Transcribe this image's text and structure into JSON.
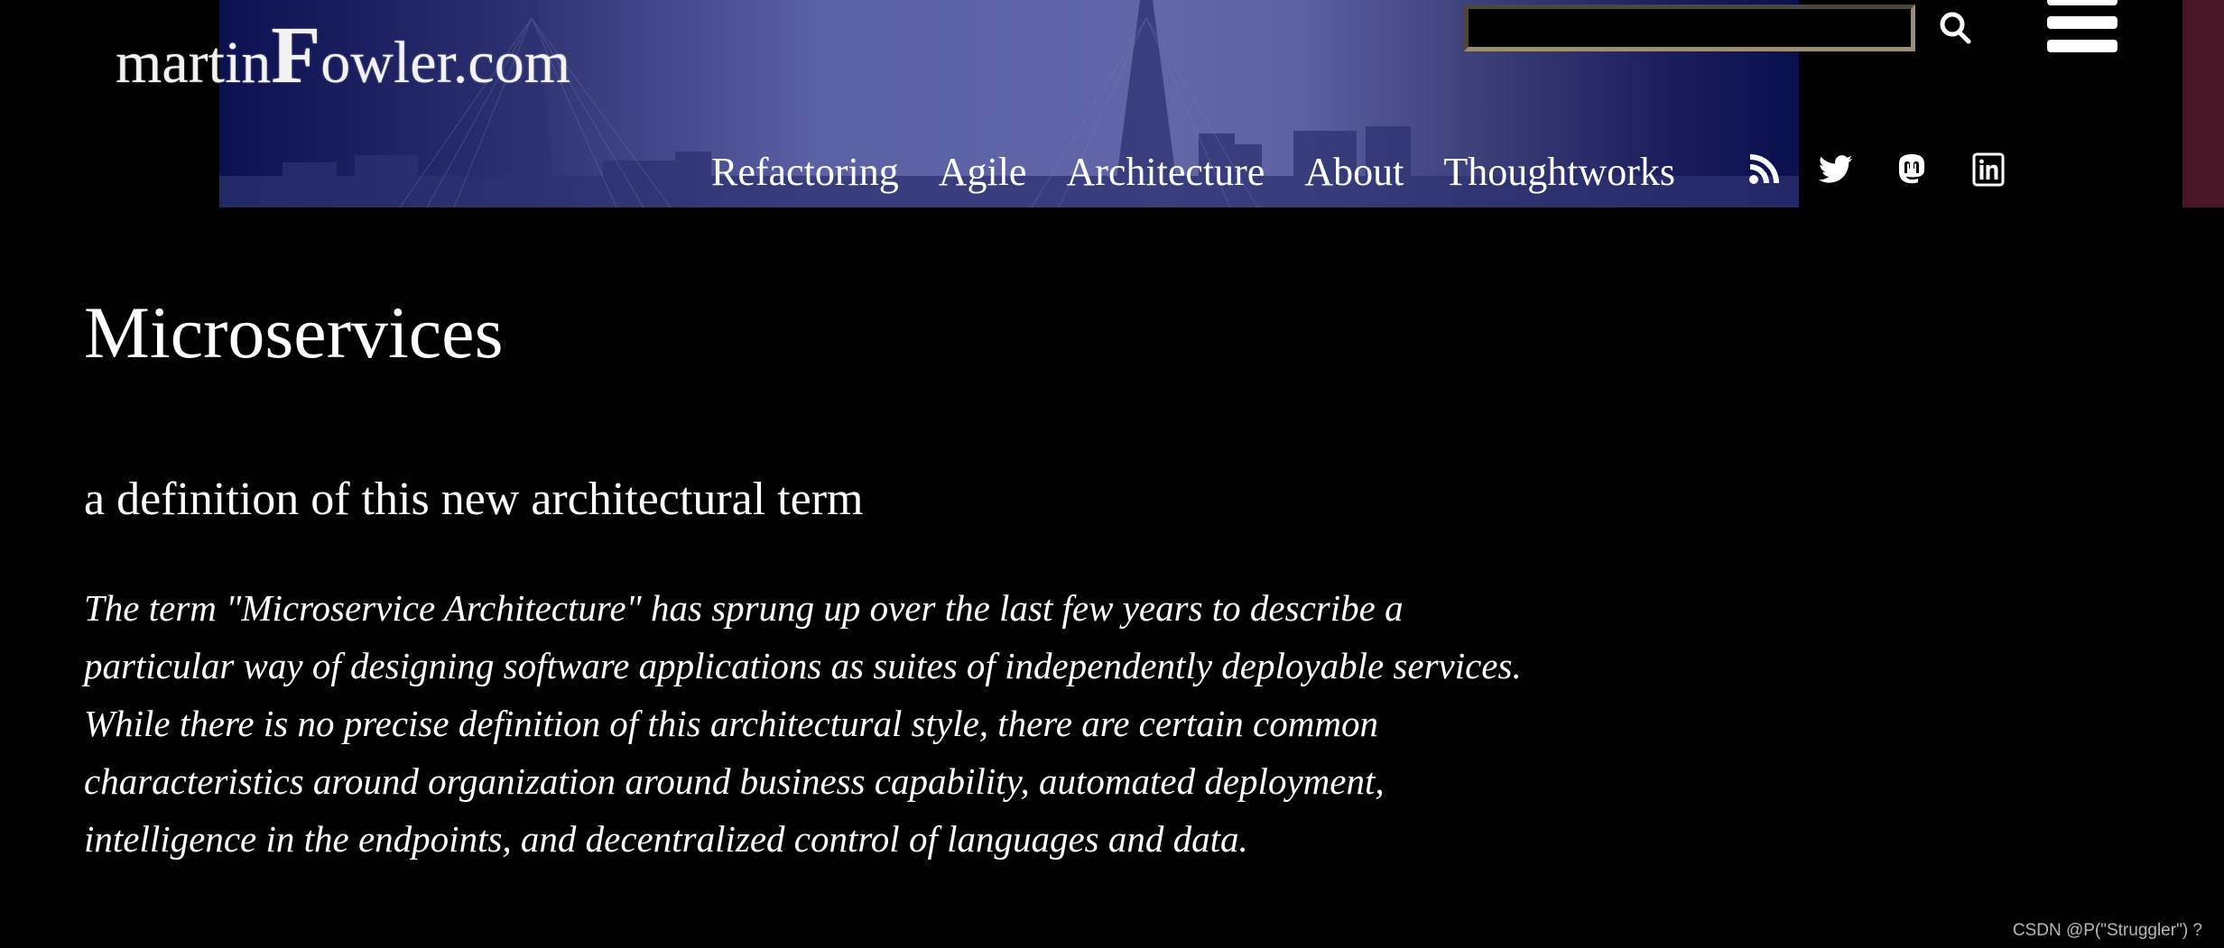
{
  "site": {
    "logo_part1": "martin",
    "logo_big": "F",
    "logo_part2": "owler.com"
  },
  "search": {
    "value": "",
    "placeholder": "",
    "icon": "search-icon"
  },
  "menu": {
    "icon": "hamburger-menu-icon"
  },
  "nav": {
    "items": [
      {
        "label": "Refactoring"
      },
      {
        "label": "Agile"
      },
      {
        "label": "Architecture"
      },
      {
        "label": "About"
      },
      {
        "label": "Thoughtworks"
      }
    ],
    "social": [
      {
        "name": "rss-icon",
        "label": "RSS"
      },
      {
        "name": "twitter-icon",
        "label": "Twitter"
      },
      {
        "name": "mastodon-icon",
        "label": "Mastodon"
      },
      {
        "name": "linkedin-icon",
        "label": "LinkedIn"
      }
    ]
  },
  "article": {
    "title": "Microservices",
    "subtitle": "a definition of this new architectural term",
    "lede": "The term \"Microservice Architecture\" has sprung up over the last few years to describe a particular way of designing software applications as suites of independently deployable services. While there is no precise definition of this architectural style, there are certain common characteristics around organization around business capability, automated deployment, intelligence in the endpoints, and decentralized control of languages and data."
  },
  "watermark": "CSDN @P(\"Struggler\") ?",
  "colors": {
    "background": "#000000",
    "banner_light": "#6066a6",
    "banner_dark": "#08104e",
    "maroon_strip": "#4a1526",
    "text": "#ffffff"
  }
}
